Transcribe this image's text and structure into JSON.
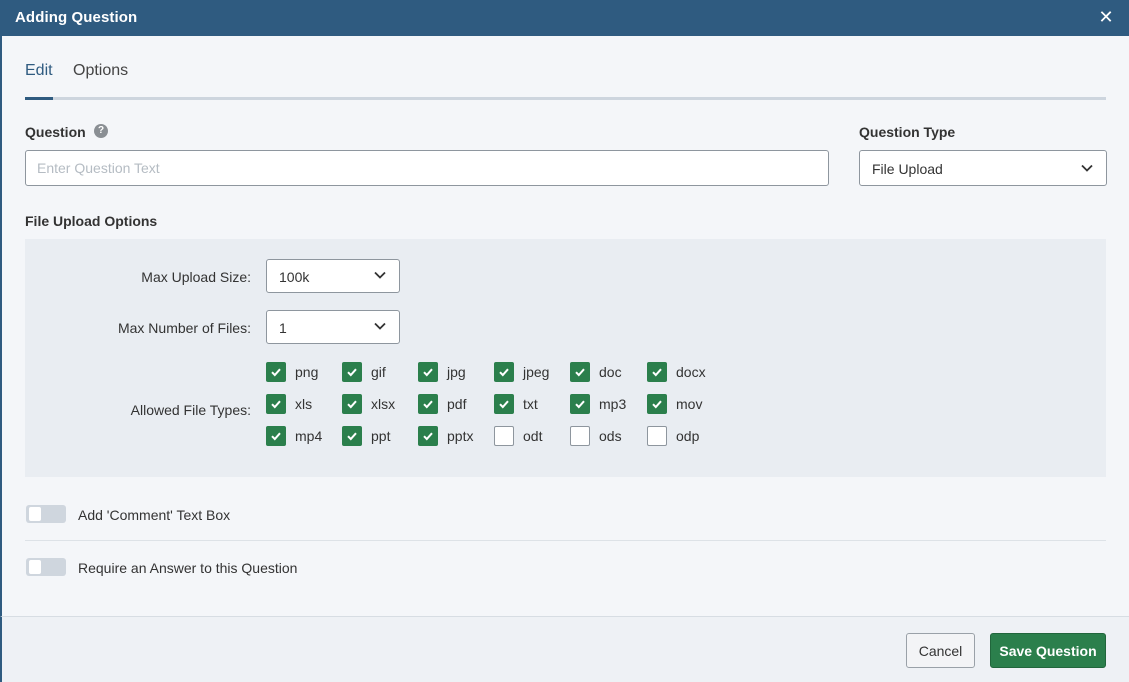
{
  "dialog": {
    "title": "Adding Question",
    "close_glyph": "✕"
  },
  "tabs": [
    {
      "label": "Edit",
      "active": true
    },
    {
      "label": "Options",
      "active": false
    }
  ],
  "question": {
    "label": "Question",
    "help_glyph": "?",
    "placeholder": "Enter Question Text",
    "value": ""
  },
  "question_type": {
    "label": "Question Type",
    "selected": "File Upload"
  },
  "file_upload": {
    "section_label": "File Upload Options",
    "max_upload_size": {
      "label": "Max Upload Size:",
      "selected": "100k"
    },
    "max_files": {
      "label": "Max Number of Files:",
      "selected": "1"
    },
    "allowed_types_label": "Allowed File Types:",
    "file_types": [
      {
        "name": "png",
        "checked": true
      },
      {
        "name": "gif",
        "checked": true
      },
      {
        "name": "jpg",
        "checked": true
      },
      {
        "name": "jpeg",
        "checked": true
      },
      {
        "name": "doc",
        "checked": true
      },
      {
        "name": "docx",
        "checked": true
      },
      {
        "name": "xls",
        "checked": true
      },
      {
        "name": "xlsx",
        "checked": true
      },
      {
        "name": "pdf",
        "checked": true
      },
      {
        "name": "txt",
        "checked": true
      },
      {
        "name": "mp3",
        "checked": true
      },
      {
        "name": "mov",
        "checked": true
      },
      {
        "name": "mp4",
        "checked": true
      },
      {
        "name": "ppt",
        "checked": true
      },
      {
        "name": "pptx",
        "checked": true
      },
      {
        "name": "odt",
        "checked": false
      },
      {
        "name": "ods",
        "checked": false
      },
      {
        "name": "odp",
        "checked": false
      }
    ]
  },
  "toggles": {
    "comment": {
      "label": "Add 'Comment' Text Box",
      "on": false
    },
    "require": {
      "label": "Require an Answer to this Question",
      "on": false
    }
  },
  "footer": {
    "cancel_label": "Cancel",
    "save_label": "Save Question"
  },
  "colors": {
    "header": "#2f5b80",
    "accent_green": "#2b7f4c"
  }
}
